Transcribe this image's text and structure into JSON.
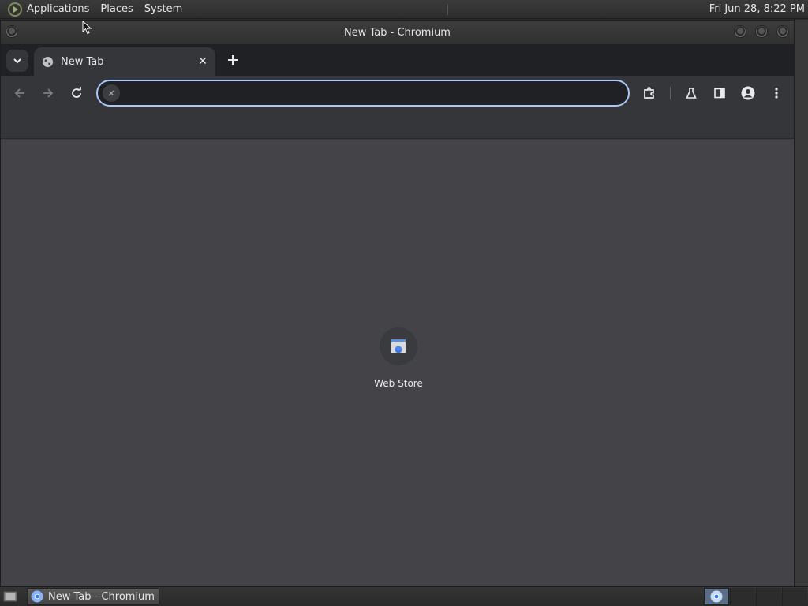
{
  "top_panel": {
    "menus": [
      "Applications",
      "Places",
      "System"
    ],
    "clock": "Fri Jun 28,  8:22 PM"
  },
  "window": {
    "title": "New Tab - Chromium"
  },
  "tabs": [
    {
      "label": "New Tab",
      "active": true
    }
  ],
  "omnibox": {
    "value": "",
    "placeholder": ""
  },
  "shortcuts": [
    {
      "label": "Web Store",
      "icon": "web-store-icon"
    }
  ],
  "taskbar": {
    "tasks": [
      {
        "label": "New Tab - Chromium",
        "icon": "chromium-icon"
      }
    ]
  },
  "colors": {
    "accent": "#a8c7fa",
    "content_bg": "#434348",
    "tabstrip_bg": "#202124",
    "toolbar_bg": "#35363a"
  }
}
